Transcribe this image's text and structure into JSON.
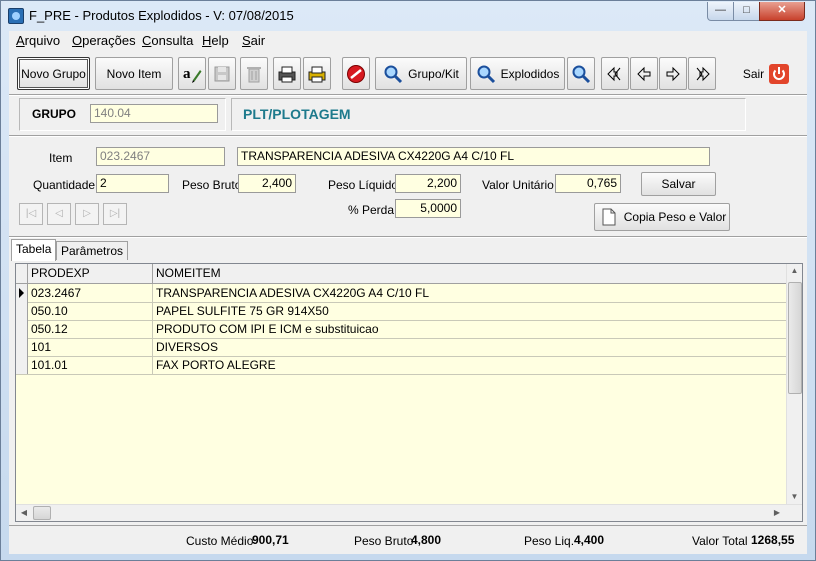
{
  "window": {
    "title": "F_PRE - Produtos Explodidos - V: 07/08/2015"
  },
  "menu": [
    {
      "label": "Arquivo",
      "first": "A",
      "rest": "rquivo"
    },
    {
      "label": "Operações",
      "first": "O",
      "rest": "perações"
    },
    {
      "label": "Consulta",
      "first": "C",
      "rest": "onsulta"
    },
    {
      "label": "Help",
      "first": "H",
      "rest": "elp"
    },
    {
      "label": "Sair",
      "first": "S",
      "rest": "air"
    }
  ],
  "toolbar": {
    "novo_grupo": "Novo Grupo",
    "novo_item": "Novo Item",
    "grupo_kit": "Grupo/Kit",
    "explodidos": "Explodidos",
    "sair": "Sair"
  },
  "grupo": {
    "label": "GRUPO",
    "code": "140.04",
    "name": "PLT/PLOTAGEM"
  },
  "form": {
    "item_label": "Item",
    "item_code": "023.2467",
    "item_desc": "TRANSPARENCIA ADESIVA CX4220G A4 C/10 FL",
    "quantidade_label": "Quantidade",
    "quantidade": "2",
    "peso_bruto_label": "Peso Bruto",
    "peso_bruto": "2,400",
    "peso_liquido_label": "Peso Líquido",
    "peso_liquido": "2,200",
    "valor_unitario_label": "Valor Unitário",
    "valor_unitario": "0,765",
    "salvar": "Salvar",
    "perda_label": "% Perda",
    "perda": "5,0000",
    "copia": "Copia Peso e Valor"
  },
  "tabs": [
    "Tabela",
    "Parâmetros"
  ],
  "table": {
    "columns": [
      "PRODEXP",
      "NOMEITEM"
    ],
    "rows": [
      [
        "023.2467",
        "TRANSPARENCIA ADESIVA CX4220G A4 C/10 FL"
      ],
      [
        "050.10",
        "PAPEL SULFITE 75 GR 914X50"
      ],
      [
        "050.12",
        "PRODUTO COM IPI E ICM e substituicao"
      ],
      [
        "101",
        "DIVERSOS"
      ],
      [
        "101.01",
        "FAX PORTO ALEGRE"
      ]
    ]
  },
  "status": {
    "custo_medio_label": "Custo Médio",
    "custo_medio": "900,71",
    "peso_bruto_label": "Peso Bruto",
    "peso_bruto": "4,800",
    "peso_liq_label": "Peso Liq.",
    "peso_liq": "4,400",
    "valor_total_label": "Valor Total",
    "valor_total": "1268,55"
  },
  "colors": {
    "title_teal": "#1e7a8c",
    "field_bg": "#ffffe1",
    "close_red": "#c8412c"
  }
}
